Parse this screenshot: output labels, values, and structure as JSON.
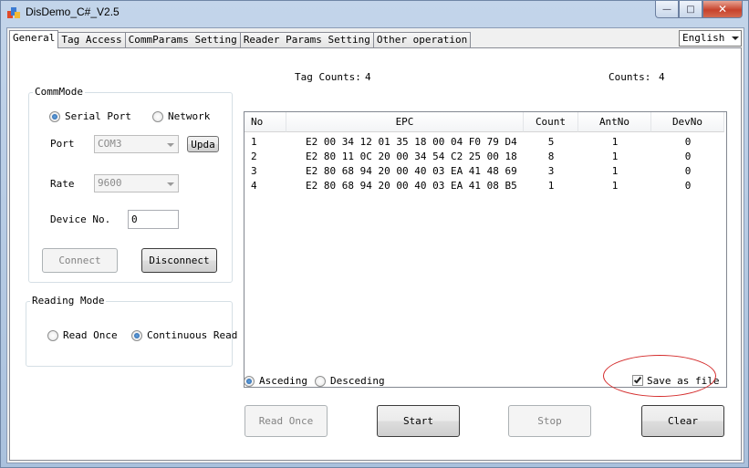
{
  "window": {
    "title": "DisDemo_C#_V2.5",
    "minimize_glyph": "—",
    "maximize_glyph": "□",
    "close_glyph": "✕"
  },
  "tabs": [
    {
      "label": "General"
    },
    {
      "label": "Tag Access"
    },
    {
      "label": "CommParams Setting"
    },
    {
      "label": "Reader Params Setting"
    },
    {
      "label": "Other operation"
    }
  ],
  "language": {
    "selected": "English"
  },
  "commmode": {
    "title": "CommMode",
    "serial_label": "Serial Port",
    "network_label": "Network",
    "port_label": "Port",
    "port_value": "COM3",
    "update_label": "Upda",
    "rate_label": "Rate",
    "rate_value": "9600",
    "device_label": "Device No.",
    "device_value": "0",
    "connect_label": "Connect",
    "disconnect_label": "Disconnect"
  },
  "reading_mode": {
    "title": "Reading Mode",
    "read_once_label": "Read Once",
    "continuous_label": "Continuous Read"
  },
  "counts": {
    "tag_counts_label": "Tag Counts:",
    "tag_counts_value": "4",
    "counts_label": "Counts:",
    "counts_value": "4"
  },
  "table": {
    "columns": [
      "No",
      "EPC",
      "Count",
      "AntNo",
      "DevNo"
    ],
    "rows": [
      [
        "1",
        "E2 00 34 12 01 35 18 00 04 F0 79 D4",
        "5",
        "1",
        "0"
      ],
      [
        "2",
        "E2 80 11 0C 20 00 34 54 C2 25 00 18",
        "8",
        "1",
        "0"
      ],
      [
        "3",
        "E2 80 68 94 20 00 40 03 EA 41 48 69",
        "3",
        "1",
        "0"
      ],
      [
        "4",
        "E2 80 68 94 20 00 40 03 EA 41 08 B5",
        "1",
        "1",
        "0"
      ]
    ]
  },
  "sort": {
    "ascending_label": "Asceding",
    "descending_label": "Desceding"
  },
  "save_as_file_label": "Save as file",
  "actions": {
    "read_once_label": "Read Once",
    "start_label": "Start",
    "stop_label": "Stop",
    "clear_label": "Clear"
  },
  "colors": {
    "annotation": "#d42b2b",
    "radio_selected": "#1c5aa6"
  }
}
